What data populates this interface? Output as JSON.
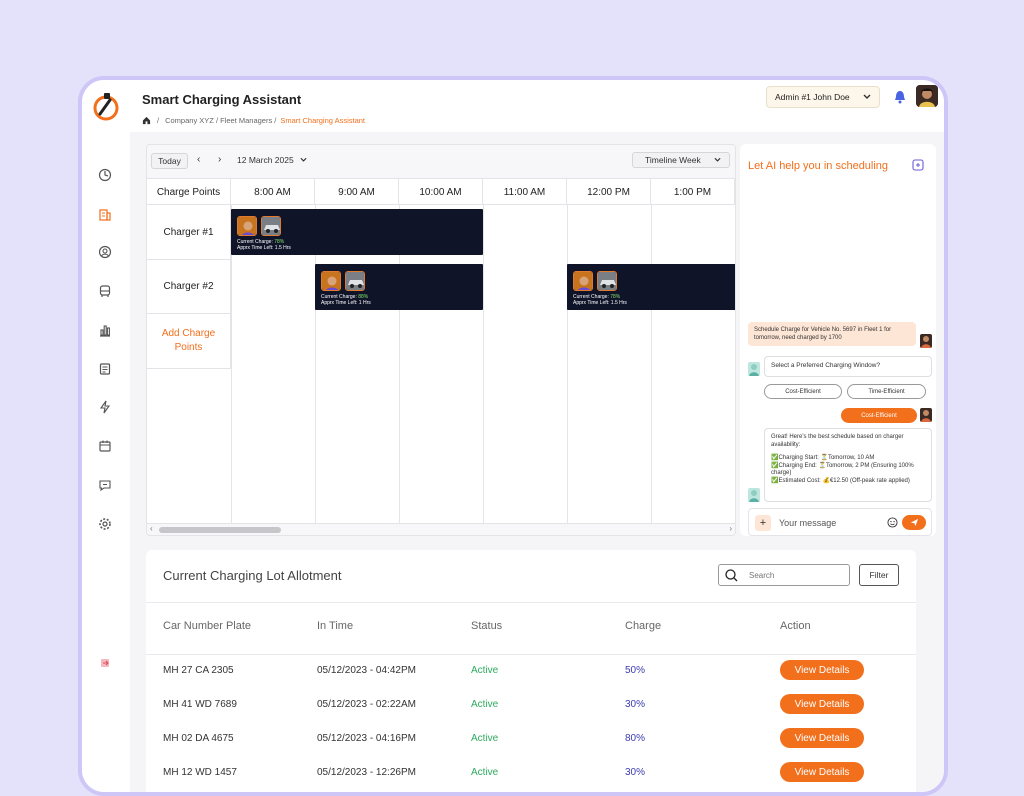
{
  "app": {
    "title": "Smart Charging Assistant"
  },
  "breadcrumb": {
    "sep": "/",
    "path": "Company XYZ / Fleet Managers /",
    "current": "Smart Charging Assistant"
  },
  "user": {
    "label": "Admin #1 John Doe"
  },
  "scheduler": {
    "today_label": "Today",
    "prev": "‹",
    "next": "›",
    "date": "12 March 2025",
    "view": "Timeline Week",
    "corner_label": "Charge Points",
    "times": [
      "8:00 AM",
      "9:00 AM",
      "10:00 AM",
      "11:00 AM",
      "12:00 PM",
      "1:00 PM"
    ],
    "rows": [
      "Charger #1",
      "Charger #2"
    ],
    "add_row": "Add Charge Points",
    "events": [
      {
        "charge_label": "Current Charge:",
        "charge": "78%",
        "time_label": "Apprx Time Left:",
        "time": "1.5 Hrs"
      },
      {
        "charge_label": "Current Charge:",
        "charge": "88%",
        "time_label": "Apprx Time Left:",
        "time": "1 Hrs"
      },
      {
        "charge_label": "Current Charge:",
        "charge": "78%",
        "time_label": "Apprx Time Left:",
        "time": "1.5 Hrs"
      }
    ]
  },
  "ai": {
    "title": "Let AI help  you in scheduling",
    "user_msg_1": "Schedule Charge for Vehicle No. 5697 in Fleet 1 for tomorrow, need charged by 1700",
    "bot_question": "Select a Preferred Charging Window?",
    "option_1": "Cost-Efficient",
    "option_2": "Time-Efficient",
    "user_choice": "Cost-Efficient",
    "bot_reply_intro": "Great! Here's the best schedule based on charger availability:",
    "bot_reply_start": "✅Charging Start: ⏳Tomorrow, 10 AM",
    "bot_reply_end": "✅Charging End: ⏳Tomorrow, 2 PM (Ensuring 100% charge)",
    "bot_reply_cost": "✅Estimated Cost: 💰€12.50 (Off-peak rate applied)",
    "input_placeholder": "Your message"
  },
  "allotment": {
    "title": "Current Charging Lot Allotment",
    "search_placeholder": "Search",
    "filter_label": "Filter",
    "columns": [
      "Car Number Plate",
      "In Time",
      "Status",
      "Charge",
      "Action"
    ],
    "rows": [
      {
        "plate": "MH 27 CA 2305",
        "time": "05/12/2023 - 04:42PM",
        "status": "Active",
        "charge": "50%",
        "action": "View Details"
      },
      {
        "plate": "MH 41 WD 7689",
        "time": "05/12/2023 - 02:22AM",
        "status": "Active",
        "charge": "30%",
        "action": "View Details"
      },
      {
        "plate": "MH 02 DA 4675",
        "time": "05/12/2023 - 04:16PM",
        "status": "Active",
        "charge": "80%",
        "action": "View Details"
      },
      {
        "plate": "MH 12 WD 1457",
        "time": "05/12/2023 - 12:26PM",
        "status": "Active",
        "charge": "30%",
        "action": "View Details"
      }
    ]
  },
  "colors": {
    "accent": "#f26f1c",
    "event_bg": "#0f1429",
    "active": "#2daa5f",
    "charge": "#3b3bb0"
  },
  "icons": [
    "logo-icon",
    "bell-icon",
    "home-icon",
    "chevron-down-icon",
    "search-icon",
    "send-icon",
    "emoji-icon",
    "plus-icon",
    "new-chat-icon"
  ]
}
